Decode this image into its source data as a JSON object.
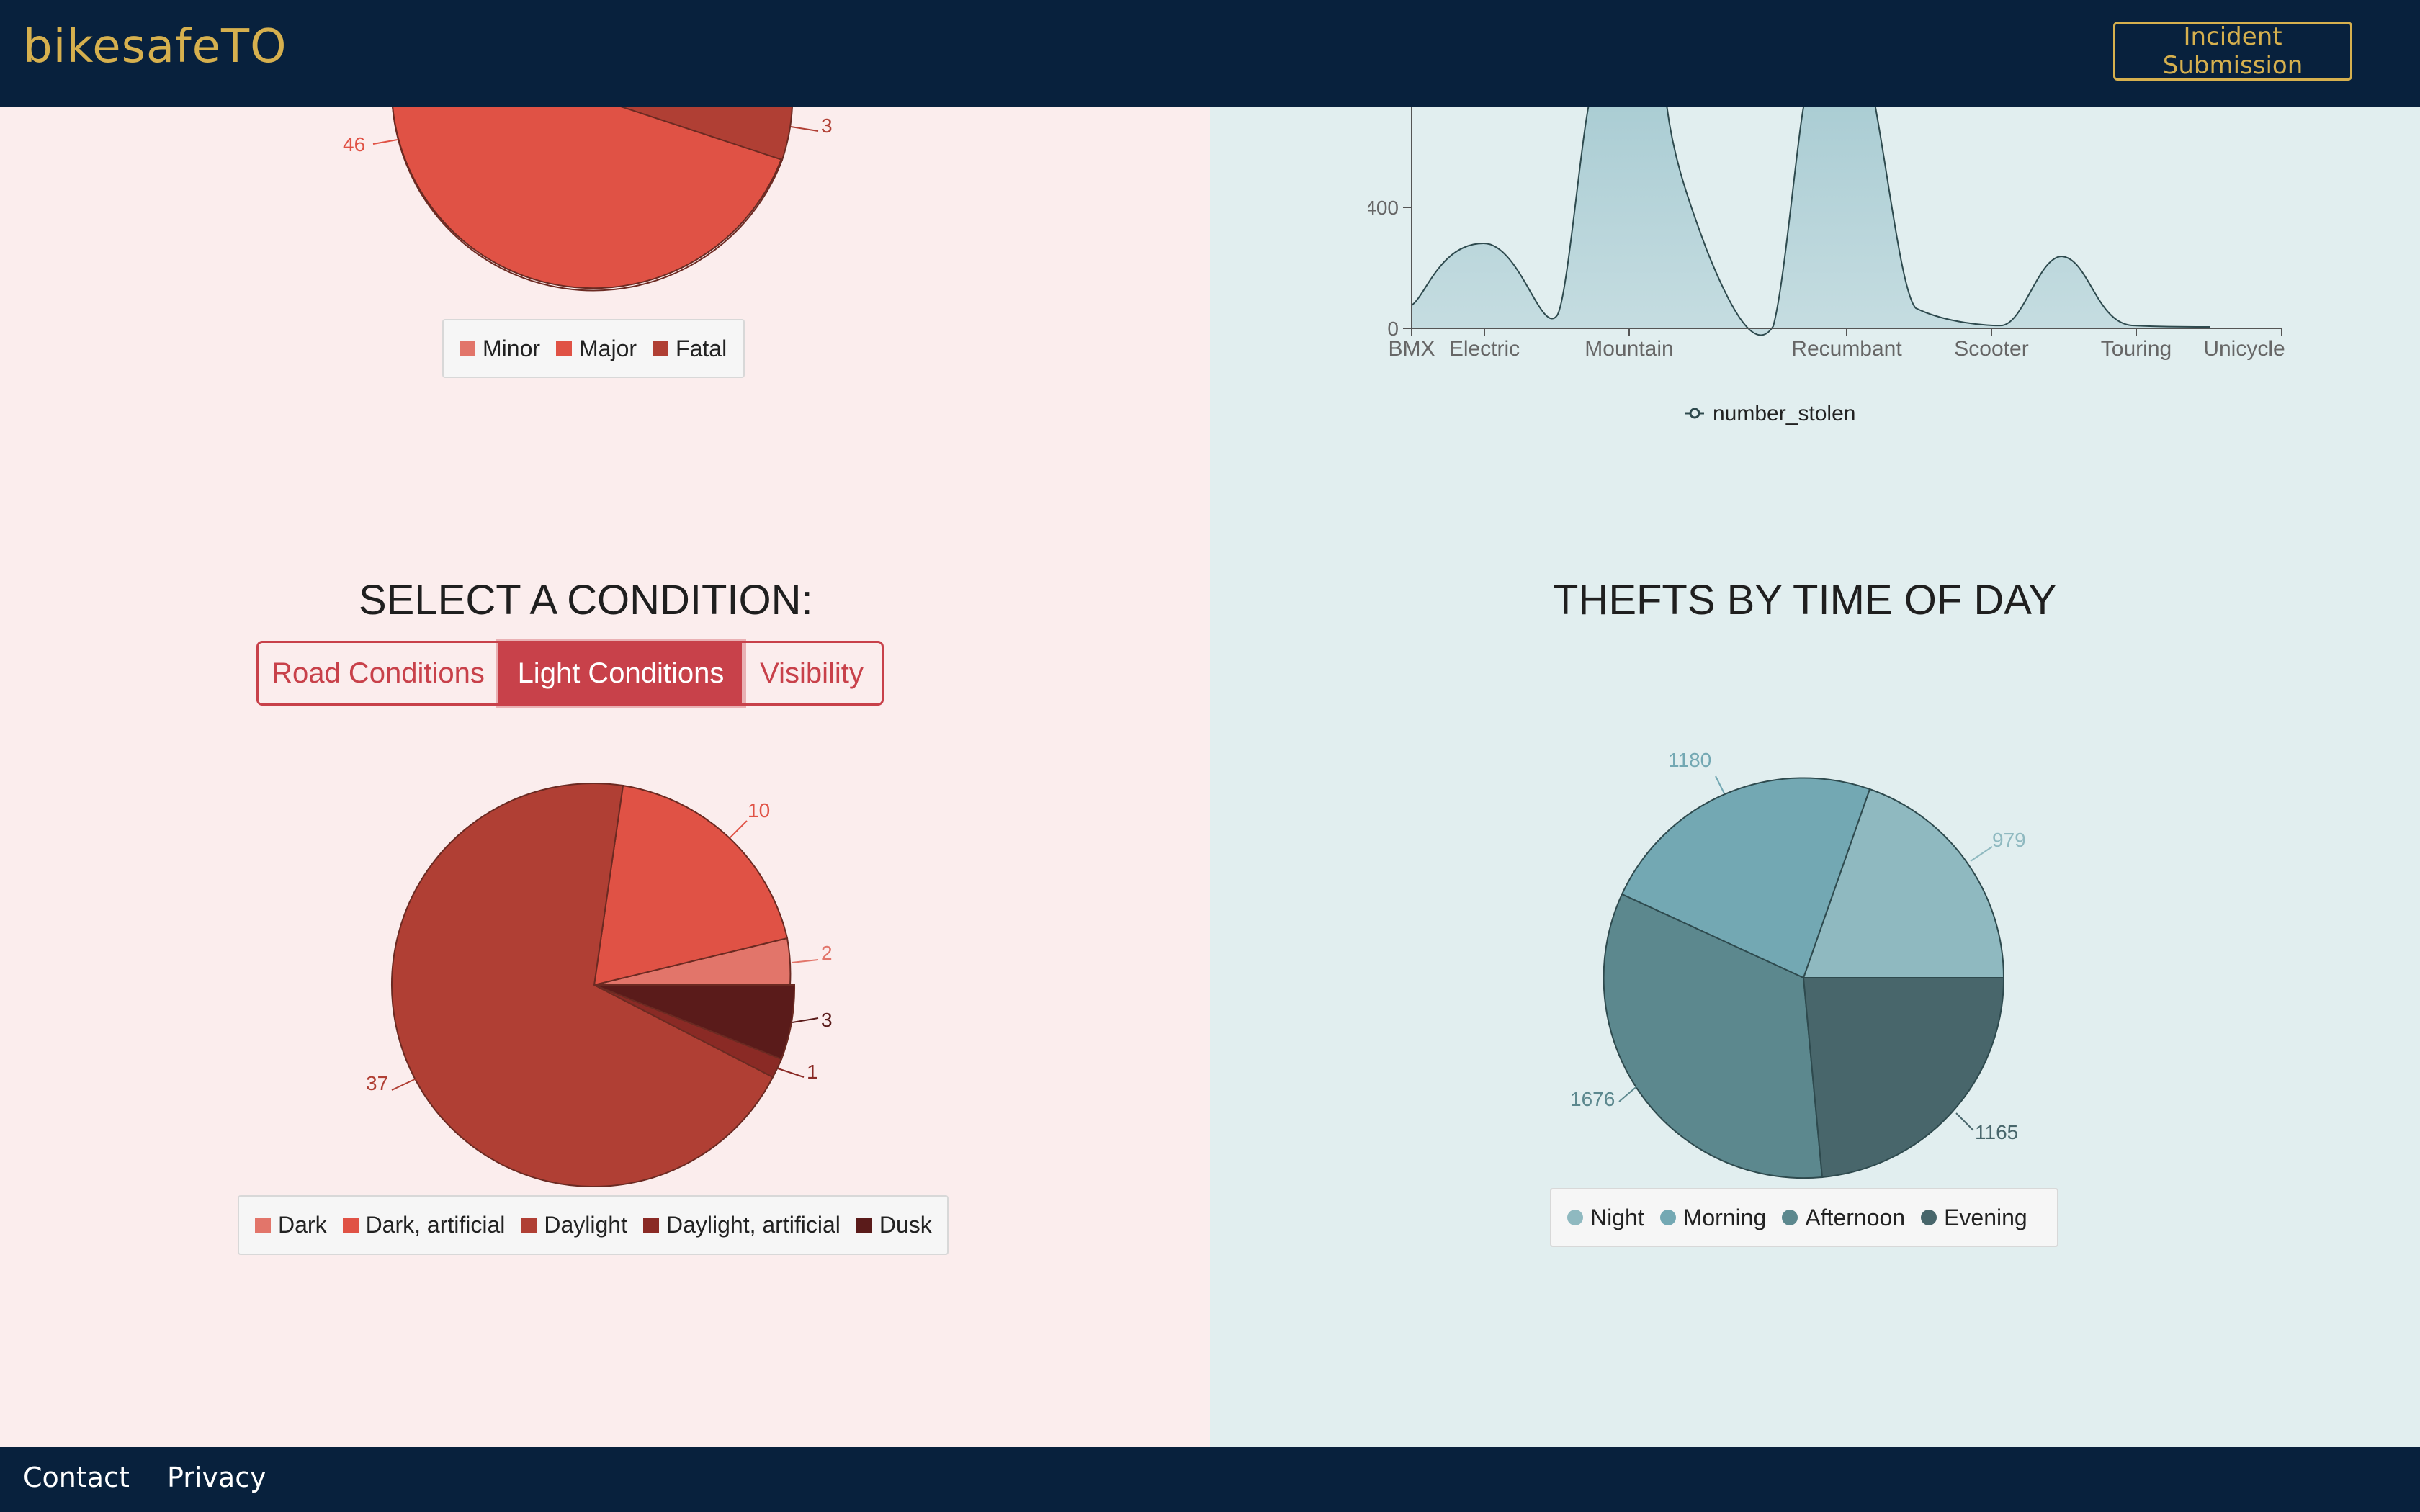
{
  "header": {
    "brand": "bikesafeTO",
    "incident_button": "Incident Submission"
  },
  "footer": {
    "contact": "Contact",
    "privacy": "Privacy"
  },
  "severity_pie": {
    "legend": [
      {
        "label": "Minor",
        "color": "#e2756a"
      },
      {
        "label": "Major",
        "color": "#e05245"
      },
      {
        "label": "Fatal",
        "color": "#b03f34"
      }
    ],
    "visible_labels": {
      "major": "46",
      "fatal": "3"
    }
  },
  "condition_selector": {
    "heading": "SELECT A CONDITION:",
    "options": [
      "Road Conditions",
      "Light Conditions",
      "Visibility"
    ],
    "selected": "Light Conditions"
  },
  "thefts_time": {
    "heading": "THEFTS BY TIME OF DAY"
  },
  "chart_data": [
    {
      "type": "pie",
      "title": "",
      "slices": [
        {
          "label": "Major",
          "value": 46,
          "color": "#e05245"
        },
        {
          "label": "Fatal",
          "value": 3,
          "color": "#b03f34"
        }
      ]
    },
    {
      "type": "area",
      "categories": [
        "BMX",
        "Electric",
        "Mountain",
        "Recumbant",
        "Scooter",
        "Touring",
        "Unicycle"
      ],
      "series": [
        {
          "name": "number_stolen"
        }
      ],
      "y_ticks": [
        "0",
        "400"
      ],
      "legend_position": "bottom"
    },
    {
      "type": "pie",
      "title": "",
      "slices": [
        {
          "label": "Dark",
          "value": 2,
          "color": "#e2756a"
        },
        {
          "label": "Dark, artificial",
          "value": 10,
          "color": "#e05245"
        },
        {
          "label": "Daylight",
          "value": 37,
          "color": "#b03f34"
        },
        {
          "label": "Daylight, artificial",
          "value": 1,
          "color": "#8a2a25"
        },
        {
          "label": "Dusk",
          "value": 3,
          "color": "#5a1b1a"
        }
      ],
      "legend_position": "bottom"
    },
    {
      "type": "pie",
      "title": "THEFTS BY TIME OF DAY",
      "slices": [
        {
          "label": "Night",
          "value": 979,
          "color": "#8fb9c0"
        },
        {
          "label": "Morning",
          "value": 1180,
          "color": "#73a8b3"
        },
        {
          "label": "Afternoon",
          "value": 1676,
          "color": "#5c888e"
        },
        {
          "label": "Evening",
          "value": 1165,
          "color": "#48666b"
        }
      ],
      "legend_position": "bottom"
    }
  ]
}
